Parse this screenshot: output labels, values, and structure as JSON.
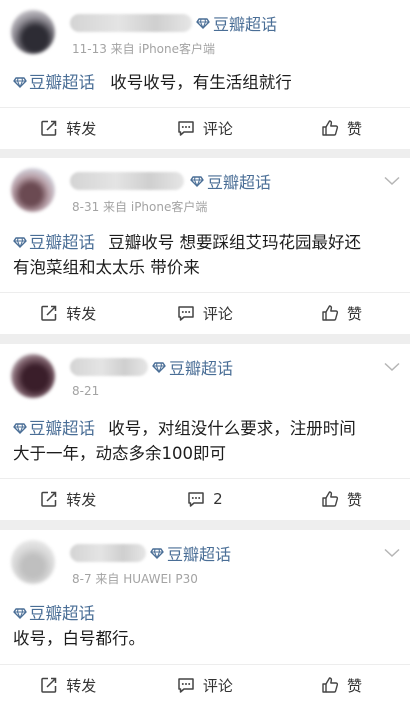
{
  "feed": {
    "posts": [
      {
        "tag": "豆瓣超话",
        "meta": "11-13  来自 iPhone客户端",
        "topic": "豆瓣超话",
        "text": "收号收号，有生活组就行",
        "text_line2": "",
        "actions": {
          "repost": "转发",
          "comment": "评论",
          "like": "赞"
        },
        "has_chevron": false
      },
      {
        "tag": "豆瓣超话",
        "meta": "8-31  来自 iPhone客户端",
        "topic": "豆瓣超话",
        "text": "豆瓣收号 想要踩组艾玛花园最好还",
        "text_line2": "有泡菜组和太太乐 带价来",
        "actions": {
          "repost": "转发",
          "comment": "评论",
          "like": "赞"
        },
        "has_chevron": true
      },
      {
        "tag": "豆瓣超话",
        "meta": "8-21",
        "topic": "豆瓣超话",
        "text": "收号，对组没什么要求，注册时间",
        "text_line2": "大于一年，动态多余100即可",
        "actions": {
          "repost": "转发",
          "comment": "2",
          "like": "赞"
        },
        "has_chevron": true
      },
      {
        "tag": "豆瓣超话",
        "meta": "8-7  来自 HUAWEI P30",
        "topic": "豆瓣超话",
        "text": "",
        "text_line2": "收号，白号都行。",
        "actions": {
          "repost": "转发",
          "comment": "评论",
          "like": "赞"
        },
        "has_chevron": true
      }
    ]
  },
  "colors": {
    "link": "#4a6e96",
    "meta": "#a3a3a3",
    "divider": "#eeeeee"
  },
  "icons": [
    "diamond-icon",
    "repost-icon",
    "comment-icon",
    "like-icon",
    "chevron-down-icon"
  ]
}
